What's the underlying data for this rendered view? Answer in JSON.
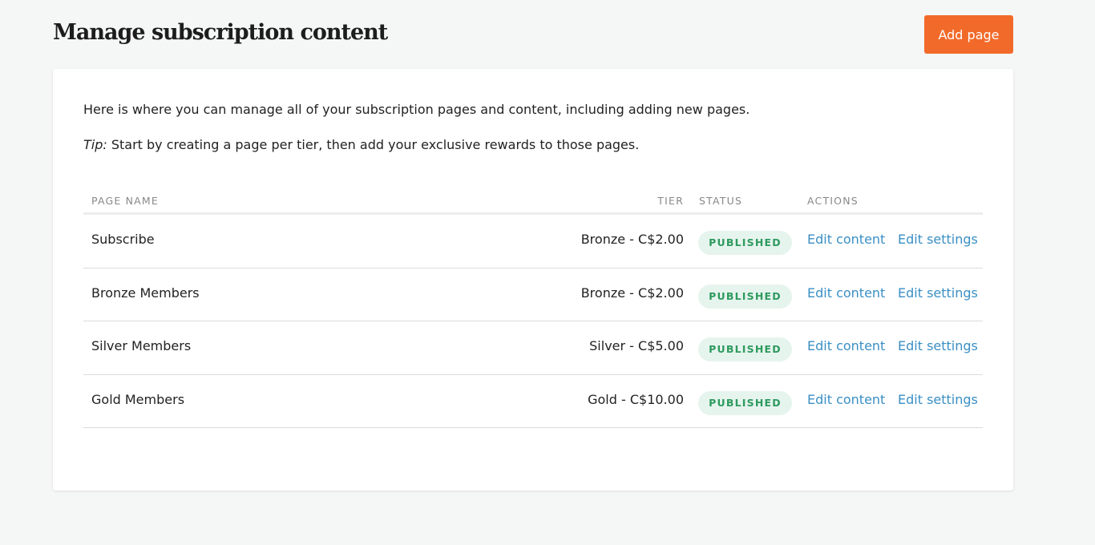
{
  "header": {
    "title": "Manage subscription content",
    "add_button_label": "Add page"
  },
  "card": {
    "intro": "Here is where you can manage all of your subscription pages and content, including adding new pages.",
    "tip_label": "Tip:",
    "tip_text": " Start by creating a page per tier, then add your exclusive rewards to those pages."
  },
  "table": {
    "columns": {
      "name": "PAGE NAME",
      "tier": "TIER",
      "status": "STATUS",
      "actions": "ACTIONS"
    },
    "rows": [
      {
        "name": "Subscribe",
        "tier": "Bronze - C$2.00",
        "status": "PUBLISHED",
        "edit_content": "Edit content",
        "edit_settings": "Edit settings"
      },
      {
        "name": "Bronze Members",
        "tier": "Bronze - C$2.00",
        "status": "PUBLISHED",
        "edit_content": "Edit content",
        "edit_settings": "Edit settings"
      },
      {
        "name": "Silver Members",
        "tier": "Silver - C$5.00",
        "status": "PUBLISHED",
        "edit_content": "Edit content",
        "edit_settings": "Edit settings"
      },
      {
        "name": "Gold Members",
        "tier": "Gold - C$10.00",
        "status": "PUBLISHED",
        "edit_content": "Edit content",
        "edit_settings": "Edit settings"
      }
    ]
  },
  "colors": {
    "accent": "#f26a2a",
    "link": "#3a8fc4",
    "badge_bg": "#e6f4ee",
    "badge_text": "#2e9a5e",
    "background": "#f5f6f6"
  }
}
